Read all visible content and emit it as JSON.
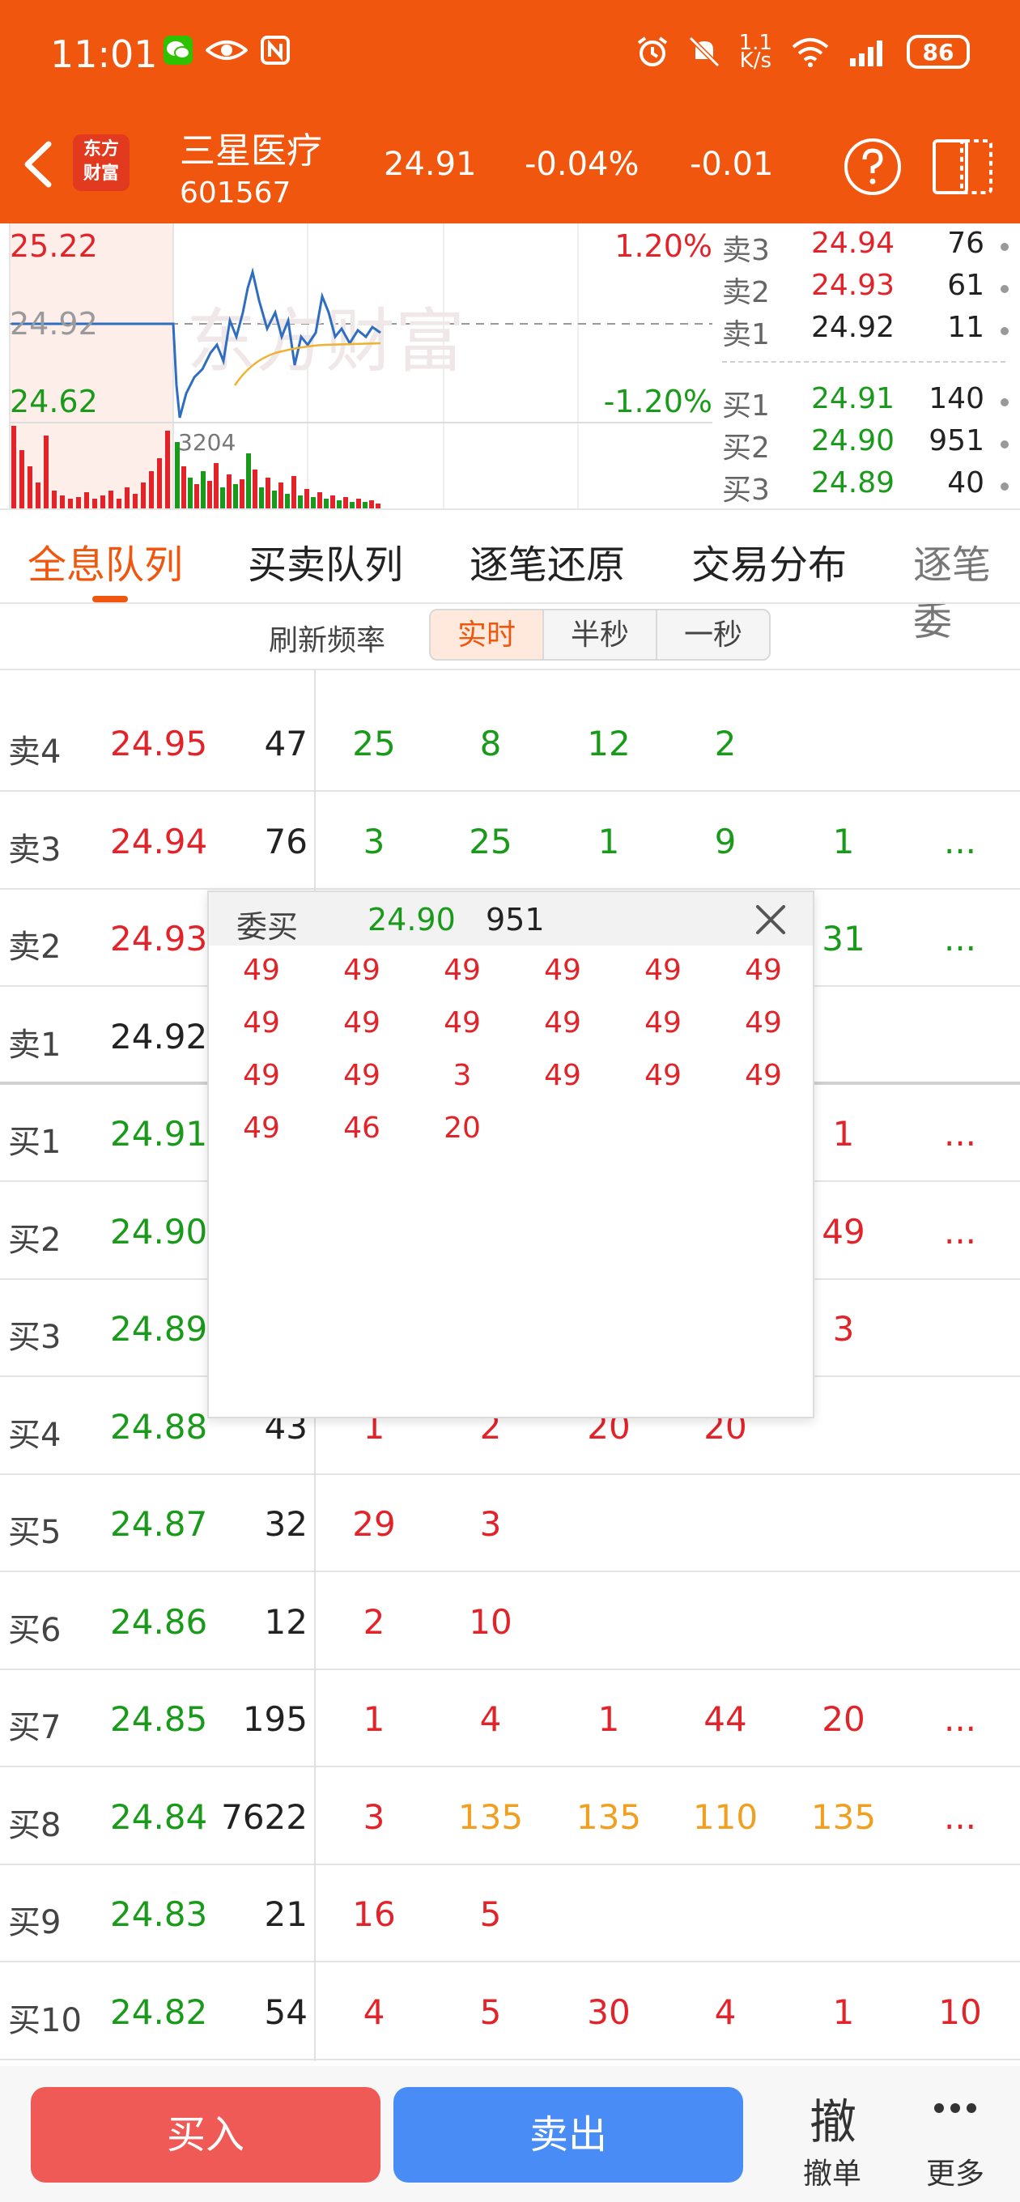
{
  "status_bar": {
    "time": "11:01",
    "net_speed_top": "1.1",
    "net_speed_bottom": "K/s",
    "battery": "86"
  },
  "header": {
    "logo_line1": "东方",
    "logo_line2": "财富",
    "name": "三星医疗",
    "code": "601567",
    "price": "24.91",
    "change_pct": "-0.04%",
    "change": "-0.01"
  },
  "chart": {
    "high": "25.22",
    "low": "24.62",
    "mid": "24.92",
    "high_pct": "1.20%",
    "low_pct": "-1.20%",
    "volume_label": "3204"
  },
  "order_book": {
    "asks": [
      {
        "label": "卖3",
        "price": "24.94",
        "volume": "76"
      },
      {
        "label": "卖2",
        "price": "24.93",
        "volume": "61"
      },
      {
        "label": "卖1",
        "price": "24.92",
        "volume": "11"
      }
    ],
    "bids": [
      {
        "label": "买1",
        "price": "24.91",
        "volume": "140"
      },
      {
        "label": "买2",
        "price": "24.90",
        "volume": "951"
      },
      {
        "label": "买3",
        "price": "24.89",
        "volume": "40"
      }
    ]
  },
  "tabs": [
    "全息队列",
    "买卖队列",
    "逐笔还原",
    "交易分布",
    "逐笔委"
  ],
  "refresh": {
    "label": "刷新频率",
    "options": [
      "实时",
      "半秒",
      "一秒"
    ]
  },
  "queue_rows": [
    {
      "label": "卖4",
      "price": "24.95",
      "volume": "47",
      "q": [
        "25",
        "8",
        "12",
        "2",
        "",
        ""
      ]
    },
    {
      "label": "卖3",
      "price": "24.94",
      "volume": "76",
      "q": [
        "3",
        "25",
        "1",
        "9",
        "1",
        "..."
      ]
    },
    {
      "label": "卖2",
      "price": "24.93",
      "volume": "",
      "q": [
        "",
        "",
        "",
        "",
        "31",
        "..."
      ]
    },
    {
      "label": "卖1",
      "price": "24.92",
      "volume": "",
      "q": [
        "",
        "",
        "",
        "",
        "",
        ""
      ]
    },
    {
      "label": "买1",
      "price": "24.91",
      "volume": "",
      "q": [
        "",
        "",
        "",
        "",
        "1",
        "..."
      ]
    },
    {
      "label": "买2",
      "price": "24.90",
      "volume": "",
      "q": [
        "",
        "",
        "",
        "",
        "49",
        "..."
      ]
    },
    {
      "label": "买3",
      "price": "24.89",
      "volume": "",
      "q": [
        "",
        "",
        "",
        "",
        "3",
        ""
      ]
    },
    {
      "label": "买4",
      "price": "24.88",
      "volume": "43",
      "q": [
        "1",
        "2",
        "20",
        "20",
        "",
        ""
      ]
    },
    {
      "label": "买5",
      "price": "24.87",
      "volume": "32",
      "q": [
        "29",
        "3",
        "",
        "",
        "",
        ""
      ]
    },
    {
      "label": "买6",
      "price": "24.86",
      "volume": "12",
      "q": [
        "2",
        "10",
        "",
        "",
        "",
        ""
      ]
    },
    {
      "label": "买7",
      "price": "24.85",
      "volume": "195",
      "q": [
        "1",
        "4",
        "1",
        "44",
        "20",
        "..."
      ]
    },
    {
      "label": "买8",
      "price": "24.84",
      "volume": "7622",
      "q": [
        "3",
        "135",
        "135",
        "110",
        "135",
        "..."
      ]
    },
    {
      "label": "买9",
      "price": "24.83",
      "volume": "21",
      "q": [
        "16",
        "5",
        "",
        "",
        "",
        ""
      ]
    },
    {
      "label": "买10",
      "price": "24.82",
      "volume": "54",
      "q": [
        "4",
        "5",
        "30",
        "4",
        "1",
        "10"
      ]
    }
  ],
  "popup": {
    "title": "委买",
    "price": "24.90",
    "volume": "951",
    "values": [
      "49",
      "49",
      "49",
      "49",
      "49",
      "49",
      "49",
      "49",
      "49",
      "49",
      "49",
      "49",
      "49",
      "49",
      "3",
      "49",
      "49",
      "49",
      "49",
      "46",
      "20"
    ]
  },
  "bottom": {
    "buy": "买入",
    "sell": "卖出",
    "cancel_icon": "撤",
    "cancel": "撤单",
    "more": "更多"
  }
}
